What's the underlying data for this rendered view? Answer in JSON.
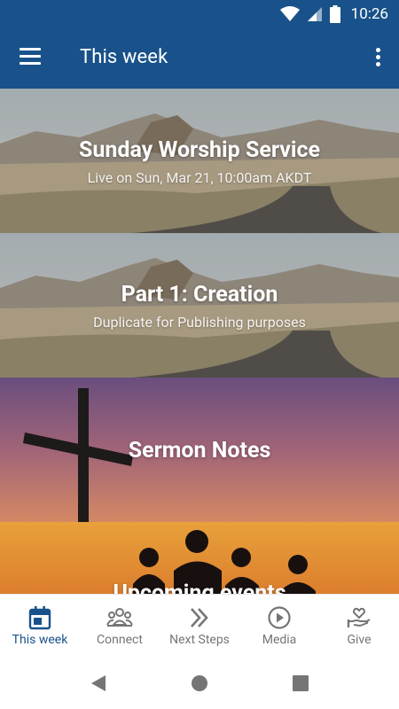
{
  "status_bar": {
    "time": "10:26"
  },
  "app_bar": {
    "title": "This week"
  },
  "cards": [
    {
      "title": "Sunday Worship Service",
      "subtitle": "Live on Sun, Mar 21, 10:00am AKDT"
    },
    {
      "title": "Part 1: Creation",
      "subtitle": "Duplicate for Publishing purposes"
    },
    {
      "title": "Sermon Notes"
    },
    {
      "title": "Upcoming events"
    }
  ],
  "bottom_nav": {
    "items": [
      {
        "label": "This week",
        "icon": "calendar-icon",
        "active": true
      },
      {
        "label": "Connect",
        "icon": "people-icon"
      },
      {
        "label": "Next Steps",
        "icon": "double-chevron-icon"
      },
      {
        "label": "Media",
        "icon": "play-circle-icon"
      },
      {
        "label": "Give",
        "icon": "heart-hand-icon"
      }
    ]
  },
  "colors": {
    "primary": "#19528a",
    "inactive": "#757575"
  }
}
